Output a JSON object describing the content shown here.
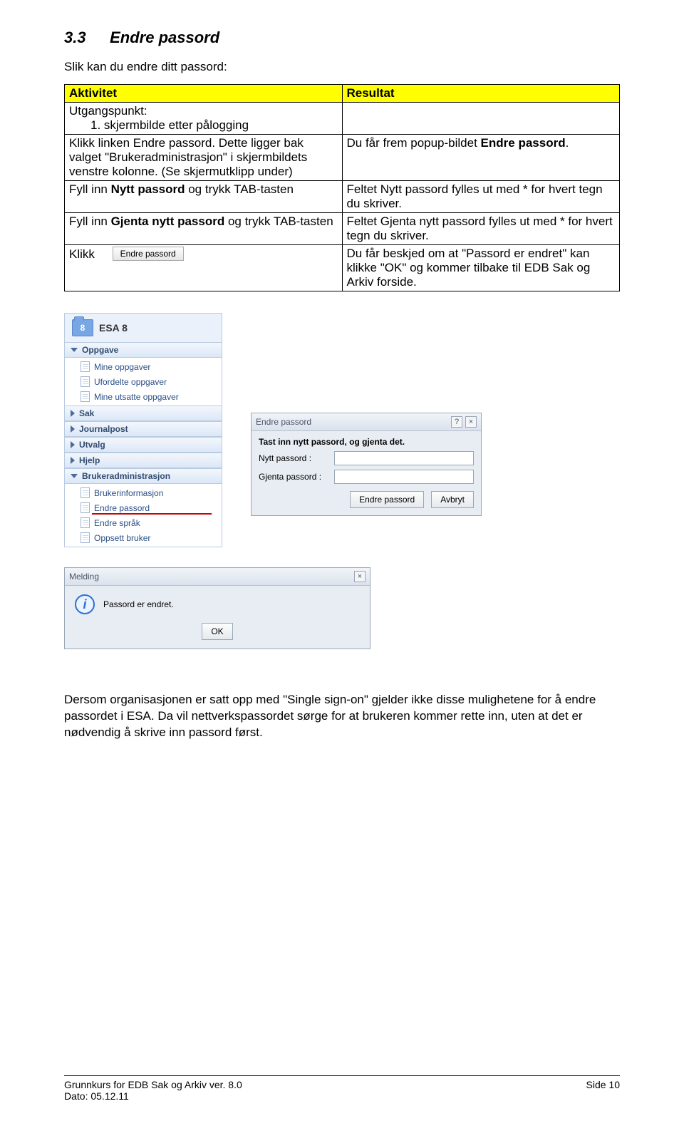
{
  "heading": {
    "number": "3.3",
    "title": "Endre passord"
  },
  "intro": "Slik kan du endre ditt passord:",
  "table": {
    "headers": {
      "col1": "Aktivitet",
      "col2": "Resultat"
    },
    "rows": [
      {
        "a_line1": "Utgangspunkt:",
        "a_li": "1.  skjermbilde etter pålogging",
        "r": ""
      },
      {
        "a": "Klikk linken Endre passord. Dette ligger bak valget \"Brukeradministrasjon\" i skjermbildets venstre kolonne. (Se skjermutklipp under)",
        "r_pre": "Du får frem popup-bildet ",
        "r_bold": "Endre passord",
        "r_post": "."
      },
      {
        "a_pre": "Fyll inn ",
        "a_bold": "Nytt passord",
        "a_post": " og trykk TAB-tasten",
        "r": "Feltet Nytt passord fylles ut med * for hvert tegn du skriver."
      },
      {
        "a_pre": "Fyll inn ",
        "a_bold": "Gjenta nytt passord",
        "a_post": " og trykk TAB-tasten",
        "r": "Feltet Gjenta nytt passord fylles ut med * for hvert tegn du skriver."
      },
      {
        "a": "Klikk",
        "btn": "Endre passord",
        "r": "Du får beskjed om at \"Passord er endret\" kan klikke \"OK\" og kommer tilbake til EDB Sak og Arkiv forside."
      }
    ]
  },
  "sidebar": {
    "appTitle": "ESA 8",
    "folderBadge": "8",
    "sections": [
      {
        "label": "Oppgave",
        "open": true,
        "items": [
          "Mine oppgaver",
          "Ufordelte oppgaver",
          "Mine utsatte oppgaver"
        ]
      },
      {
        "label": "Sak",
        "open": false
      },
      {
        "label": "Journalpost",
        "open": false
      },
      {
        "label": "Utvalg",
        "open": false
      },
      {
        "label": "Hjelp",
        "open": false
      },
      {
        "label": "Brukeradministrasjon",
        "open": true,
        "items": [
          "Brukerinformasjon",
          "Endre passord",
          "Endre språk",
          "Oppsett bruker"
        ],
        "highlightIndex": 1
      }
    ]
  },
  "dlg": {
    "title": "Endre passord",
    "helpGlyph": "?",
    "closeGlyph": "×",
    "prompt": "Tast inn nytt passord, og gjenta det.",
    "labelNew": "Nytt passord :",
    "labelRepeat": "Gjenta passord :",
    "btnSubmit": "Endre passord",
    "btnCancel": "Avbryt"
  },
  "melding": {
    "title": "Melding",
    "closeGlyph": "×",
    "text": "Passord er endret.",
    "ok": "OK"
  },
  "closing": "Dersom organisasjonen er satt opp med \"Single sign-on\" gjelder ikke disse mulighetene for å endre passordet i ESA. Da vil nettverkspassordet sørge for at brukeren kommer rette inn, uten at det er nødvendig å skrive inn passord først.",
  "footer": {
    "leftLine1": "Grunnkurs for EDB Sak og Arkiv ver. 8.0",
    "leftLine2": "Dato: 05.12.11",
    "right": "Side 10"
  }
}
